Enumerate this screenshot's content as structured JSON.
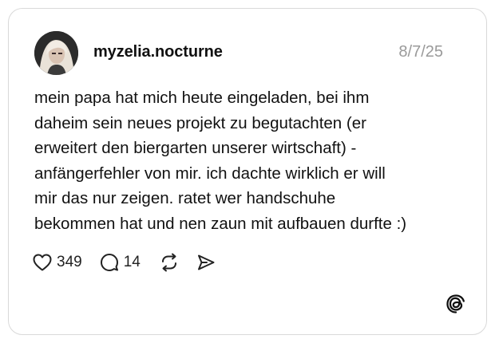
{
  "post": {
    "username": "myzelia.nocturne",
    "date": "8/7/25",
    "lines": [
      "mein papa hat mich heute eingeladen, bei ihm",
      "daheim sein neues projekt zu begutachten (er",
      "erweitert den biergarten unserer wirtschaft) -",
      "anfängerfehler von mir. ich dachte wirklich er will",
      "mir das nur zeigen. ratet wer handschuhe",
      "bekommen hat und nen zaun mit aufbauen durfte :)"
    ]
  },
  "actions": {
    "likes": "349",
    "replies": "14"
  },
  "icons": {
    "like": "heart-icon",
    "reply": "comment-icon",
    "repost": "repost-icon",
    "share": "send-icon",
    "brand": "threads-logo-icon"
  }
}
